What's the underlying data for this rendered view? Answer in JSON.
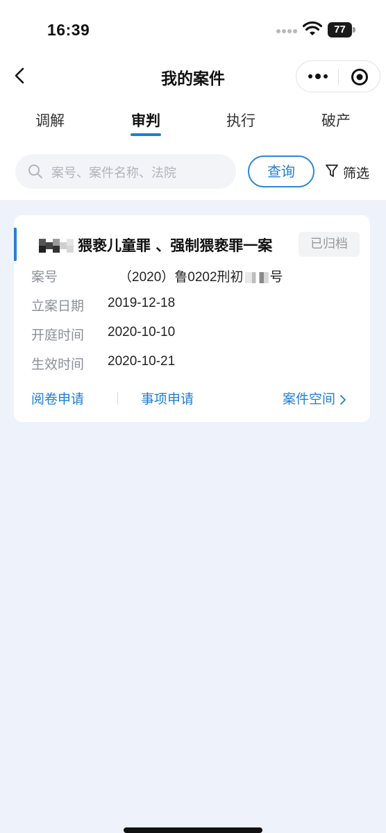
{
  "status_bar": {
    "time": "16:39",
    "battery": "77"
  },
  "nav": {
    "title": "我的案件"
  },
  "tabs": [
    {
      "label": "调解"
    },
    {
      "label": "审判"
    },
    {
      "label": "执行"
    },
    {
      "label": "破产"
    }
  ],
  "active_tab": "审判",
  "search": {
    "placeholder": "案号、案件名称、法院",
    "query_label": "查询",
    "filter_label": "筛选"
  },
  "case_card": {
    "title": "猥亵儿童罪 、强制猥亵罪一案",
    "status": "已归档",
    "fields": [
      {
        "label": "案号",
        "value_prefix": "（2020）鲁0202刑初",
        "value_suffix": "号"
      },
      {
        "label": "立案日期",
        "value": "2019-12-18"
      },
      {
        "label": "开庭时间",
        "value": "2020-10-10"
      },
      {
        "label": "生效时间",
        "value": "2020-10-21"
      }
    ],
    "actions": {
      "read_file": "阅卷申请",
      "matter_apply": "事项申请",
      "case_space": "案件空间"
    }
  },
  "colors": {
    "accent": "#1e7ed6",
    "background": "#eef2fa",
    "badge_bg": "#f2f3f5"
  },
  "icons": [
    "back-icon",
    "more-icon",
    "target-icon",
    "search-icon",
    "filter-icon",
    "chevron-right-icon",
    "wifi-icon",
    "battery-icon"
  ]
}
